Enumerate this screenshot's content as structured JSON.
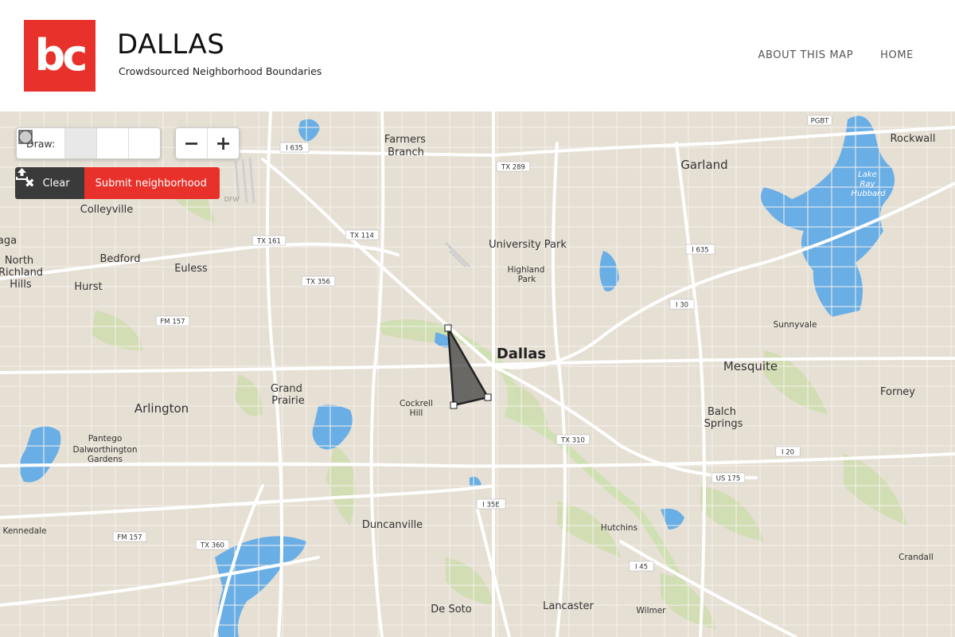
{
  "header": {
    "logo_text": "bc",
    "title": "DALLAS",
    "subtitle": "Crowdsourced Neighborhood Boundaries",
    "nav": [
      "ABOUT THIS MAP",
      "HOME"
    ]
  },
  "toolbar": {
    "draw_label": "Draw:",
    "draw_tools": [
      "polygon-icon",
      "rectangle-icon",
      "circle-icon"
    ],
    "active_tool": "polygon",
    "zoom_out": "−",
    "zoom_in": "+",
    "clear_label": "Clear",
    "submit_label": "Submit neighborhood"
  },
  "map": {
    "places": {
      "dallas": "Dallas",
      "farmers_branch_1": "Farmers",
      "farmers_branch_2": "Branch",
      "garland": "Garland",
      "rockwall": "Rockwall",
      "colleyville": "Colleyville",
      "university_park": "University Park",
      "highland_park_1": "Highland",
      "highland_park_2": "Park",
      "north_richland_1": "North",
      "north_richland_2": "Richland",
      "north_richland_3": "Hills",
      "bedford": "Bedford",
      "euless": "Euless",
      "hurst": "Hurst",
      "sunnyvale": "Sunnyvale",
      "mesquite": "Mesquite",
      "forney": "Forney",
      "grand_prairie_1": "Grand",
      "grand_prairie_2": "Prairie",
      "arlington": "Arlington",
      "cockrell_hill_1": "Cockrell",
      "cockrell_hill_2": "Hill",
      "balch_springs_1": "Balch",
      "balch_springs_2": "Springs",
      "pantego": "Pantego",
      "dalworthington_1": "Dalworthington",
      "dalworthington_2": "Gardens",
      "duncanville": "Duncanville",
      "hutchins": "Hutchins",
      "kennedale": "Kennedale",
      "crandall": "Crandall",
      "de_soto": "De Soto",
      "lancaster": "Lancaster",
      "wilmer": "Wilmer",
      "aga": "aga",
      "lake_ray_hubbard_1": "Lake",
      "lake_ray_hubbard_2": "Ray",
      "lake_ray_hubbard_3": "Hubbard",
      "dfw": "DFW"
    },
    "shields": [
      "I 635",
      "TX 289",
      "PGBT",
      "TX 114",
      "TX 161",
      "I 635",
      "TX 356",
      "I 30",
      "FM 157",
      "TX 310",
      "I 20",
      "US 175",
      "I 35E",
      "FM 157",
      "TX 360",
      "I 45"
    ],
    "colors": {
      "land": "#e6dfd3",
      "water": "#6aaee6",
      "park": "#c6dba0",
      "road": "#ffffff",
      "polygon_fill": "#4a4a4a",
      "polygon_stroke": "#222222"
    }
  }
}
